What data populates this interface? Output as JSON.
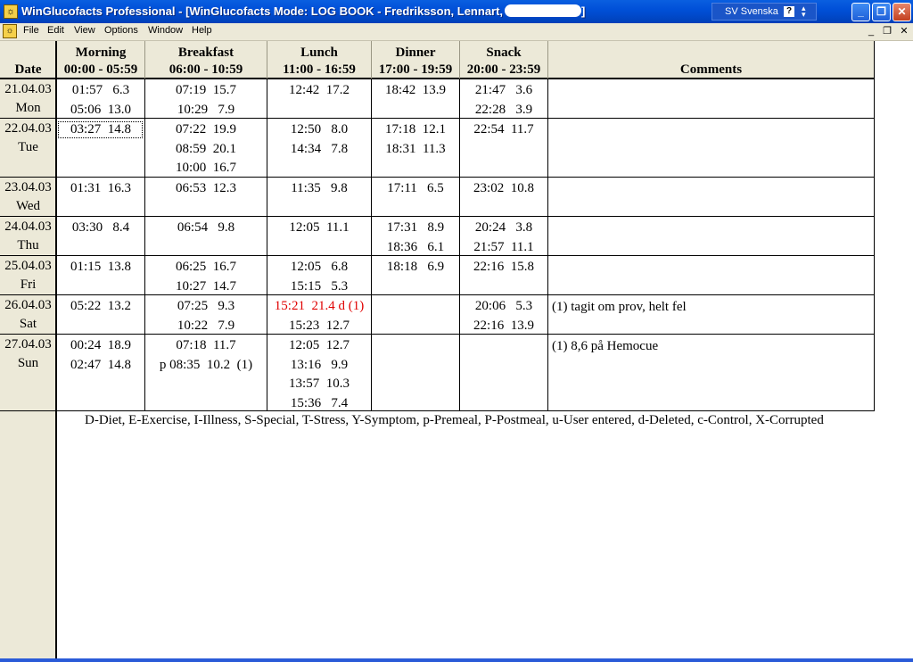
{
  "window": {
    "title": "WinGlucofacts Professional - [WinGlucofacts Mode: LOG BOOK - Fredriksson, Lennart,",
    "title_end": "]",
    "language": "SV Svenska",
    "help_glyph": "?",
    "app_icon_glyph": "☼",
    "button_glyphs": {
      "minimize": "_",
      "maximize": "❐",
      "close": "✕",
      "mdi_min": "_",
      "mdi_restore": "❐",
      "mdi_close": "✕"
    }
  },
  "menu": {
    "file": "File",
    "edit": "Edit",
    "view": "View",
    "options": "Options",
    "window": "Window",
    "help": "Help"
  },
  "logbook": {
    "date_header": "Date",
    "columns": [
      {
        "name": "Morning",
        "range": "00:00 - 05:59"
      },
      {
        "name": "Breakfast",
        "range": "06:00 - 10:59"
      },
      {
        "name": "Lunch",
        "range": "11:00 - 16:59"
      },
      {
        "name": "Dinner",
        "range": "17:00 - 19:59"
      },
      {
        "name": "Snack",
        "range": "20:00 - 23:59"
      }
    ],
    "comments_header": "Comments",
    "rows": [
      {
        "date": "21.04.03",
        "day": "Mon",
        "morning": [
          "01:57   6.3",
          "05:06  13.0"
        ],
        "breakfast": [
          "07:19  15.7",
          "10:29   7.9"
        ],
        "lunch": [
          "12:42  17.2"
        ],
        "dinner": [
          "18:42  13.9"
        ],
        "snack": [
          "21:47   3.6",
          "22:28   3.9"
        ],
        "comments": []
      },
      {
        "date": "22.04.03",
        "day": "Tue",
        "morning": [
          "03:27  14.8"
        ],
        "breakfast": [
          "07:22  19.9",
          "08:59  20.1",
          "10:00  16.7"
        ],
        "lunch": [
          "12:50   8.0",
          "14:34   7.8"
        ],
        "dinner": [
          "17:18  12.1",
          "18:31  11.3"
        ],
        "snack": [
          "22:54  11.7"
        ],
        "comments": []
      },
      {
        "date": "23.04.03",
        "day": "Wed",
        "morning": [
          "01:31  16.3"
        ],
        "breakfast": [
          "06:53  12.3"
        ],
        "lunch": [
          "11:35   9.8"
        ],
        "dinner": [
          "17:11   6.5"
        ],
        "snack": [
          "23:02  10.8"
        ],
        "comments": []
      },
      {
        "date": "24.04.03",
        "day": "Thu",
        "morning": [
          "03:30   8.4"
        ],
        "breakfast": [
          "06:54   9.8"
        ],
        "lunch": [
          "12:05  11.1"
        ],
        "dinner": [
          "17:31   8.9",
          "18:36   6.1"
        ],
        "snack": [
          "20:24   3.8",
          "21:57  11.1"
        ],
        "comments": []
      },
      {
        "date": "25.04.03",
        "day": "Fri",
        "morning": [
          "01:15  13.8"
        ],
        "breakfast": [
          "06:25  16.7",
          "10:27  14.7"
        ],
        "lunch": [
          "12:05   6.8",
          "15:15   5.3"
        ],
        "dinner": [
          "18:18   6.9"
        ],
        "snack": [
          "22:16  15.8"
        ],
        "comments": []
      },
      {
        "date": "26.04.03",
        "day": "Sat",
        "morning": [
          "05:22  13.2"
        ],
        "breakfast": [
          "07:25   9.3",
          "10:22   7.9"
        ],
        "lunch": [
          "15:21  21.4 d (1)",
          "15:23  12.7"
        ],
        "dinner": [],
        "snack": [
          "20:06   5.3",
          "22:16  13.9"
        ],
        "comments": [
          "(1) tagit om prov, helt fel"
        ]
      },
      {
        "date": "27.04.03",
        "day": "Sun",
        "morning": [
          "00:24  18.9",
          "02:47  14.8"
        ],
        "breakfast": [
          "07:18  11.7",
          "p 08:35  10.2  (1)"
        ],
        "lunch": [
          "12:05  12.7",
          "13:16   9.9",
          "13:57  10.3",
          "15:36   7.4"
        ],
        "dinner": [],
        "snack": [],
        "comments": [
          "(1) 8,6 på Hemocue"
        ]
      }
    ],
    "deleted_color": "#e00000",
    "legend": "D-Diet, E-Exercise, I-Illness, S-Special, T-Stress, Y-Symptom, p-Premeal, P-Postmeal, u-User entered, d-Deleted, c-Control, X-Corrupted"
  }
}
